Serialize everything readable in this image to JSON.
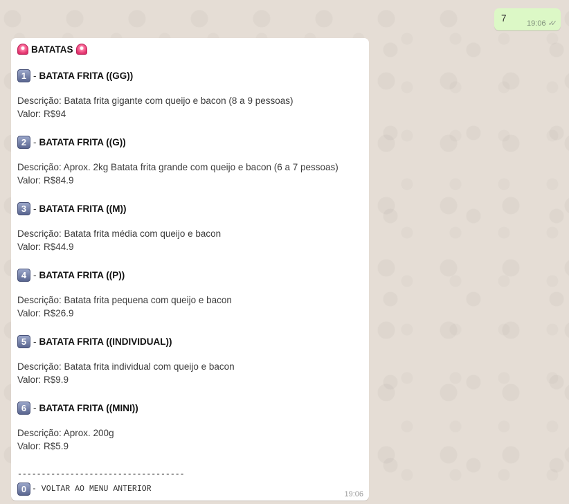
{
  "outgoing": {
    "text": "7",
    "time": "19:06",
    "read_status_icon": "double-check-icon"
  },
  "incoming": {
    "title": "BATATAS",
    "title_icon": "police-light-emoji",
    "items": [
      {
        "number": "1",
        "dash": "-",
        "name": "BATATA FRITA ((GG))",
        "description": "Descrição: Batata frita gigante com queijo e bacon (8 a 9 pessoas)",
        "price": "Valor: R$94"
      },
      {
        "number": "2",
        "dash": "-",
        "name": "BATATA FRITA ((G))",
        "description": "Descrição: Aprox. 2kg Batata frita grande com queijo e bacon (6 a 7 pessoas)",
        "price": "Valor: R$84.9"
      },
      {
        "number": "3",
        "dash": "-",
        "name": "BATATA FRITA ((M))",
        "description": "Descrição: Batata frita média com queijo e bacon",
        "price": "Valor: R$44.9"
      },
      {
        "number": "4",
        "dash": "-",
        "name": "BATATA FRITA ((P))",
        "description": "Descrição: Batata frita pequena com queijo e bacon",
        "price": "Valor: R$26.9"
      },
      {
        "number": "5",
        "dash": "-",
        "name": "BATATA FRITA ((INDIVIDUAL))",
        "description": "Descrição: Batata frita individual com queijo e bacon",
        "price": "Valor: R$9.9"
      },
      {
        "number": "6",
        "dash": "-",
        "name": "BATATA FRITA ((MINI))",
        "description": "Descrição: Aprox. 200g",
        "price": "Valor: R$5.9"
      }
    ],
    "divider": "-----------------------------------",
    "back_option": {
      "number": "0",
      "label": "- VOLTAR AO MENU ANTERIOR"
    },
    "time": "19:06"
  },
  "colors": {
    "background": "#e5ddd5",
    "outgoing_bubble": "#dcf8c6",
    "incoming_bubble": "#ffffff",
    "keycap": "#6b77a0",
    "siren": "#e0336c"
  }
}
